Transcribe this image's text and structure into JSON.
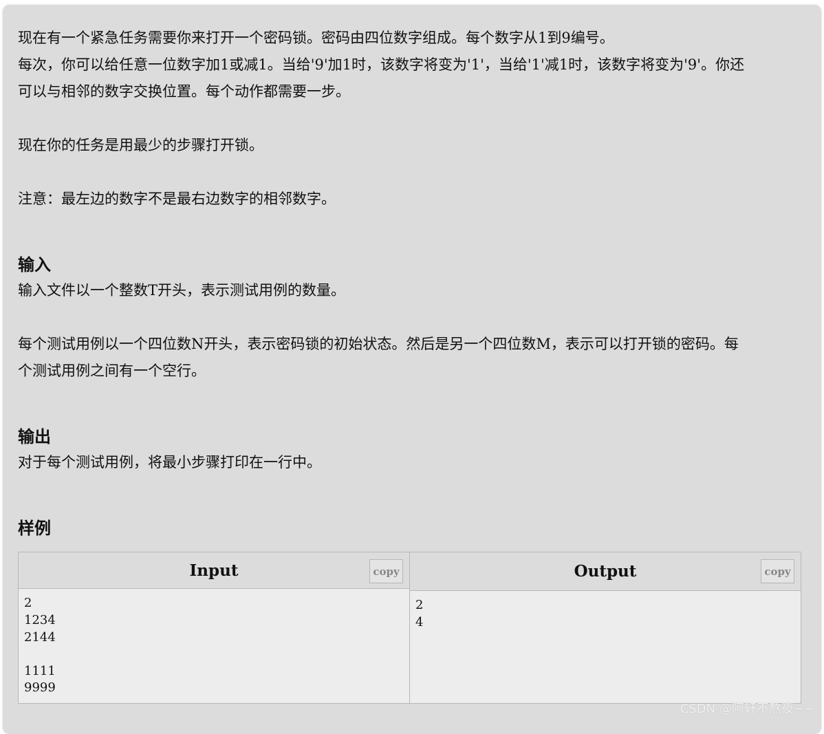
{
  "description": {
    "lines": [
      "现在有一个紧急任务需要你来打开一个密码锁。密码由四位数字组成。每个数字从1到9编号。",
      "每次，你可以给任意一位数字加1或减1。当给'9'加1时，该数字将变为'1'，当给'1'减1时，该数字将变为'9'。你还",
      "可以与相邻的数字交换位置。每个动作都需要一步。"
    ],
    "task": "现在你的任务是用最少的步骤打开锁。",
    "note": "注意：最左边的数字不是最右边数字的相邻数字。"
  },
  "input_section": {
    "title": "输入",
    "p1": "输入文件以一个整数T开头，表示测试用例的数量。",
    "p2_lines": [
      "每个测试用例以一个四位数N开头，表示密码锁的初始状态。然后是另一个四位数M，表示可以打开锁的密码。每",
      "个测试用例之间有一个空行。"
    ]
  },
  "output_section": {
    "title": "输出",
    "p1": "对于每个测试用例，将最小步骤打印在一行中。"
  },
  "sample_section": {
    "title": "样例",
    "input_header": "Input",
    "output_header": "Output",
    "copy_label": "copy",
    "input_lines": [
      "2",
      "1234",
      "2144",
      "",
      "1111",
      "9999"
    ],
    "output_lines": [
      "2",
      "4"
    ]
  },
  "watermark": "CSDN @阿轩不熬夜~~"
}
